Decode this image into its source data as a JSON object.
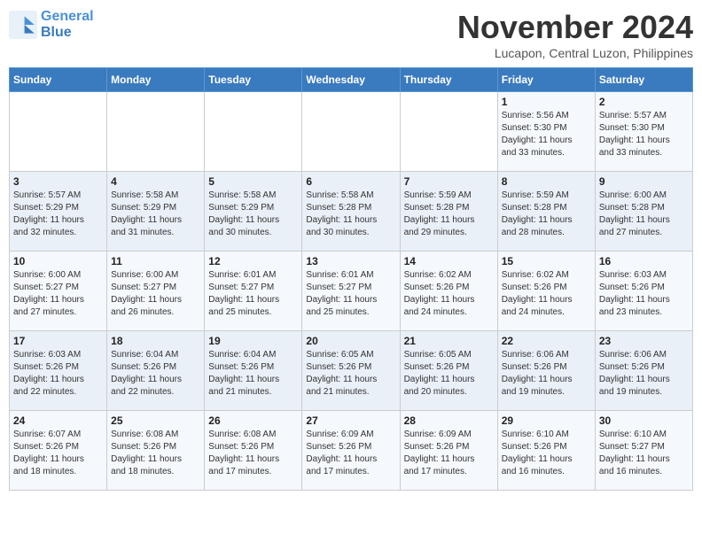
{
  "header": {
    "logo_line1": "General",
    "logo_line2": "Blue",
    "month": "November 2024",
    "location": "Lucapon, Central Luzon, Philippines"
  },
  "weekdays": [
    "Sunday",
    "Monday",
    "Tuesday",
    "Wednesday",
    "Thursday",
    "Friday",
    "Saturday"
  ],
  "weeks": [
    [
      {
        "day": "",
        "info": ""
      },
      {
        "day": "",
        "info": ""
      },
      {
        "day": "",
        "info": ""
      },
      {
        "day": "",
        "info": ""
      },
      {
        "day": "",
        "info": ""
      },
      {
        "day": "1",
        "info": "Sunrise: 5:56 AM\nSunset: 5:30 PM\nDaylight: 11 hours\nand 33 minutes."
      },
      {
        "day": "2",
        "info": "Sunrise: 5:57 AM\nSunset: 5:30 PM\nDaylight: 11 hours\nand 33 minutes."
      }
    ],
    [
      {
        "day": "3",
        "info": "Sunrise: 5:57 AM\nSunset: 5:29 PM\nDaylight: 11 hours\nand 32 minutes."
      },
      {
        "day": "4",
        "info": "Sunrise: 5:58 AM\nSunset: 5:29 PM\nDaylight: 11 hours\nand 31 minutes."
      },
      {
        "day": "5",
        "info": "Sunrise: 5:58 AM\nSunset: 5:29 PM\nDaylight: 11 hours\nand 30 minutes."
      },
      {
        "day": "6",
        "info": "Sunrise: 5:58 AM\nSunset: 5:28 PM\nDaylight: 11 hours\nand 30 minutes."
      },
      {
        "day": "7",
        "info": "Sunrise: 5:59 AM\nSunset: 5:28 PM\nDaylight: 11 hours\nand 29 minutes."
      },
      {
        "day": "8",
        "info": "Sunrise: 5:59 AM\nSunset: 5:28 PM\nDaylight: 11 hours\nand 28 minutes."
      },
      {
        "day": "9",
        "info": "Sunrise: 6:00 AM\nSunset: 5:28 PM\nDaylight: 11 hours\nand 27 minutes."
      }
    ],
    [
      {
        "day": "10",
        "info": "Sunrise: 6:00 AM\nSunset: 5:27 PM\nDaylight: 11 hours\nand 27 minutes."
      },
      {
        "day": "11",
        "info": "Sunrise: 6:00 AM\nSunset: 5:27 PM\nDaylight: 11 hours\nand 26 minutes."
      },
      {
        "day": "12",
        "info": "Sunrise: 6:01 AM\nSunset: 5:27 PM\nDaylight: 11 hours\nand 25 minutes."
      },
      {
        "day": "13",
        "info": "Sunrise: 6:01 AM\nSunset: 5:27 PM\nDaylight: 11 hours\nand 25 minutes."
      },
      {
        "day": "14",
        "info": "Sunrise: 6:02 AM\nSunset: 5:26 PM\nDaylight: 11 hours\nand 24 minutes."
      },
      {
        "day": "15",
        "info": "Sunrise: 6:02 AM\nSunset: 5:26 PM\nDaylight: 11 hours\nand 24 minutes."
      },
      {
        "day": "16",
        "info": "Sunrise: 6:03 AM\nSunset: 5:26 PM\nDaylight: 11 hours\nand 23 minutes."
      }
    ],
    [
      {
        "day": "17",
        "info": "Sunrise: 6:03 AM\nSunset: 5:26 PM\nDaylight: 11 hours\nand 22 minutes."
      },
      {
        "day": "18",
        "info": "Sunrise: 6:04 AM\nSunset: 5:26 PM\nDaylight: 11 hours\nand 22 minutes."
      },
      {
        "day": "19",
        "info": "Sunrise: 6:04 AM\nSunset: 5:26 PM\nDaylight: 11 hours\nand 21 minutes."
      },
      {
        "day": "20",
        "info": "Sunrise: 6:05 AM\nSunset: 5:26 PM\nDaylight: 11 hours\nand 21 minutes."
      },
      {
        "day": "21",
        "info": "Sunrise: 6:05 AM\nSunset: 5:26 PM\nDaylight: 11 hours\nand 20 minutes."
      },
      {
        "day": "22",
        "info": "Sunrise: 6:06 AM\nSunset: 5:26 PM\nDaylight: 11 hours\nand 19 minutes."
      },
      {
        "day": "23",
        "info": "Sunrise: 6:06 AM\nSunset: 5:26 PM\nDaylight: 11 hours\nand 19 minutes."
      }
    ],
    [
      {
        "day": "24",
        "info": "Sunrise: 6:07 AM\nSunset: 5:26 PM\nDaylight: 11 hours\nand 18 minutes."
      },
      {
        "day": "25",
        "info": "Sunrise: 6:08 AM\nSunset: 5:26 PM\nDaylight: 11 hours\nand 18 minutes."
      },
      {
        "day": "26",
        "info": "Sunrise: 6:08 AM\nSunset: 5:26 PM\nDaylight: 11 hours\nand 17 minutes."
      },
      {
        "day": "27",
        "info": "Sunrise: 6:09 AM\nSunset: 5:26 PM\nDaylight: 11 hours\nand 17 minutes."
      },
      {
        "day": "28",
        "info": "Sunrise: 6:09 AM\nSunset: 5:26 PM\nDaylight: 11 hours\nand 17 minutes."
      },
      {
        "day": "29",
        "info": "Sunrise: 6:10 AM\nSunset: 5:26 PM\nDaylight: 11 hours\nand 16 minutes."
      },
      {
        "day": "30",
        "info": "Sunrise: 6:10 AM\nSunset: 5:27 PM\nDaylight: 11 hours\nand 16 minutes."
      }
    ]
  ]
}
